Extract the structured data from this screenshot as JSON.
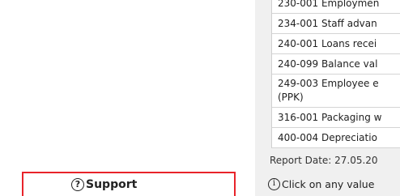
{
  "sidebar": {
    "support": {
      "icon": "question-circle-icon",
      "label": "Support",
      "highlight_color": "#e8232a"
    }
  },
  "accounts_list": [
    {
      "label": "230-001 Employmen"
    },
    {
      "label": "234-001 Staff advan"
    },
    {
      "label": "240-001 Loans recei"
    },
    {
      "label": "240-099 Balance val"
    },
    {
      "label": "249-003 Employee e",
      "label_line2": "(PPK)"
    },
    {
      "label": "316-001 Packaging w"
    },
    {
      "label": "400-004 Depreciatio"
    }
  ],
  "report": {
    "date_text": "Report Date: 27.05.20"
  },
  "info": {
    "icon": "info-circle-icon",
    "text": "Click on any value"
  }
}
